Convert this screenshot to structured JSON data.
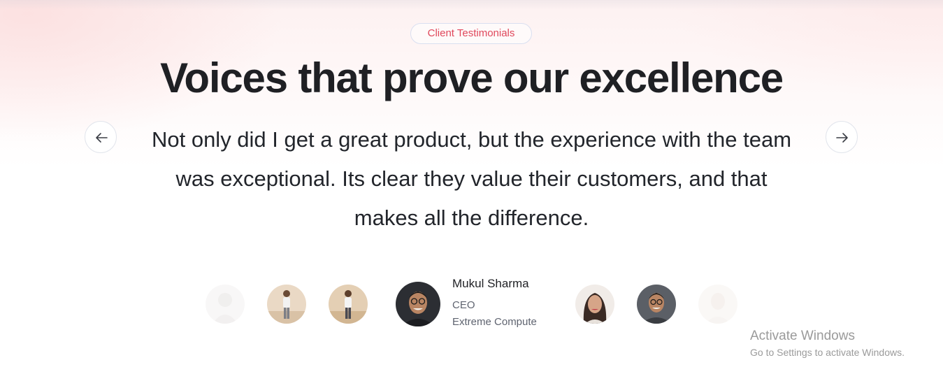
{
  "section": {
    "badge": "Client Testimonials",
    "headline": "Voices that prove our excellence",
    "quote": "Not only did I get a great product, but the experience with the team was exceptional. Its clear they value their customers, and that makes all the difference."
  },
  "navigation": {
    "prev_icon": "arrow-left-icon",
    "next_icon": "arrow-right-icon"
  },
  "active_testimonial": {
    "name": "Mukul Sharma",
    "role": "CEO",
    "company": "Extreme Compute"
  },
  "avatars": [
    {
      "icon": "avatar-faded",
      "state": "faded"
    },
    {
      "icon": "avatar-full-body",
      "state": "normal"
    },
    {
      "icon": "avatar-full-body",
      "state": "normal"
    },
    {
      "icon": "avatar-man-glasses",
      "state": "active"
    },
    {
      "icon": "avatar-woman",
      "state": "normal"
    },
    {
      "icon": "avatar-man-glasses",
      "state": "normal"
    },
    {
      "icon": "avatar-faded",
      "state": "faded"
    }
  ],
  "watermark": {
    "title": "Activate Windows",
    "subtitle": "Go to Settings to activate Windows."
  },
  "colors": {
    "accent": "#e0485c",
    "heading": "#1f2024",
    "muted": "#5f6470",
    "border": "#e2e5ec"
  }
}
